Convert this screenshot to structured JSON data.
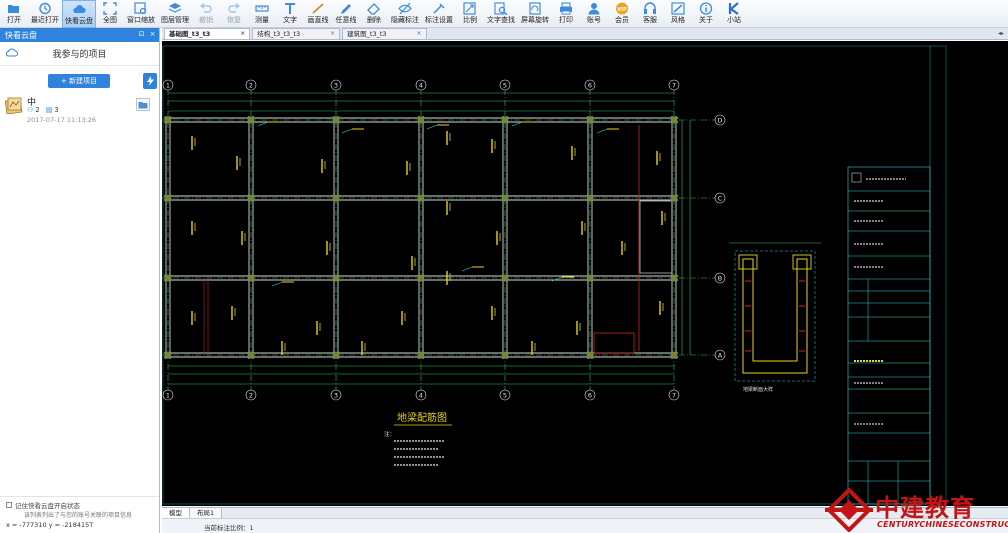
{
  "toolbar": {
    "items": [
      {
        "label": "打开",
        "icon": "folder-open-icon",
        "state": "normal"
      },
      {
        "label": "最近打开",
        "icon": "clock-icon",
        "state": "normal"
      },
      {
        "label": "快看云盘",
        "icon": "cloud-icon",
        "state": "active"
      },
      {
        "label": "全图",
        "icon": "fit-view-icon",
        "state": "normal"
      },
      {
        "label": "窗口缩放",
        "icon": "zoom-window-icon",
        "state": "normal"
      },
      {
        "label": "图层管理",
        "icon": "layers-icon",
        "state": "normal"
      },
      {
        "label": "撤销",
        "icon": "undo-icon",
        "state": "disabled"
      },
      {
        "label": "恢复",
        "icon": "redo-icon",
        "state": "disabled"
      },
      {
        "label": "测量",
        "icon": "ruler-icon",
        "state": "normal"
      },
      {
        "label": "文字",
        "icon": "text-icon",
        "state": "normal"
      },
      {
        "label": "画直线",
        "icon": "line-icon",
        "state": "normal"
      },
      {
        "label": "任意线",
        "icon": "pencil-icon",
        "state": "normal"
      },
      {
        "label": "删除",
        "icon": "eraser-icon",
        "state": "normal"
      },
      {
        "label": "隐藏标注",
        "icon": "eye-hide-icon",
        "state": "normal"
      },
      {
        "label": "标注设置",
        "icon": "annotation-settings-icon",
        "state": "normal"
      },
      {
        "label": "比例",
        "icon": "scale-icon",
        "state": "normal"
      },
      {
        "label": "文字查找",
        "icon": "text-search-icon",
        "state": "normal"
      },
      {
        "label": "屏幕旋转",
        "icon": "rotate-screen-icon",
        "state": "normal"
      },
      {
        "label": "打印",
        "icon": "printer-icon",
        "state": "normal"
      },
      {
        "label": "账号",
        "icon": "user-icon",
        "state": "normal"
      },
      {
        "label": "会员",
        "icon": "vip-icon",
        "state": "normal"
      },
      {
        "label": "客服",
        "icon": "headset-icon",
        "state": "normal"
      },
      {
        "label": "风格",
        "icon": "style-icon",
        "state": "normal"
      },
      {
        "label": "关于",
        "icon": "info-icon",
        "state": "normal"
      },
      {
        "label": "小站",
        "icon": "k-icon",
        "state": "normal"
      }
    ],
    "vip_badge": "VIP"
  },
  "sidebar": {
    "header": "快看云盘",
    "title": "我参与的项目",
    "new_project_label": "+ 新建项目",
    "project": {
      "name": "中",
      "members": "2",
      "drawings": "3",
      "date": "2017-07-17 11:13:26"
    },
    "remember_label": "记住快看云盘开启状态",
    "notice": "该列表列出了与您的账号关联的项目信息",
    "coords_text": "x = -777310  y = -218415T"
  },
  "tabs": [
    {
      "label": "基础图_t3_t3",
      "active": true
    },
    {
      "label": "结构_t3_t3_t3",
      "active": false
    },
    {
      "label": "建筑图_t3_t3",
      "active": false
    }
  ],
  "layout_tabs": [
    "模型",
    "布局1"
  ],
  "status": {
    "text": "当前标注比例：1"
  },
  "drawing": {
    "column_numbers": [
      "1",
      "2",
      "3",
      "4",
      "5",
      "6",
      "7"
    ],
    "row_letters": [
      "D",
      "C",
      "B",
      "A"
    ],
    "plan_title": "地梁配筋图",
    "section_title": "地梁断面大样",
    "notes_title": "注："
  },
  "brand": {
    "cn": "中建教育",
    "en": "CENTURYCHINESECONSTRUCTION"
  },
  "colors": {
    "accent": "#2f83dc",
    "canvas": "#000000",
    "brand": "#c31515"
  }
}
